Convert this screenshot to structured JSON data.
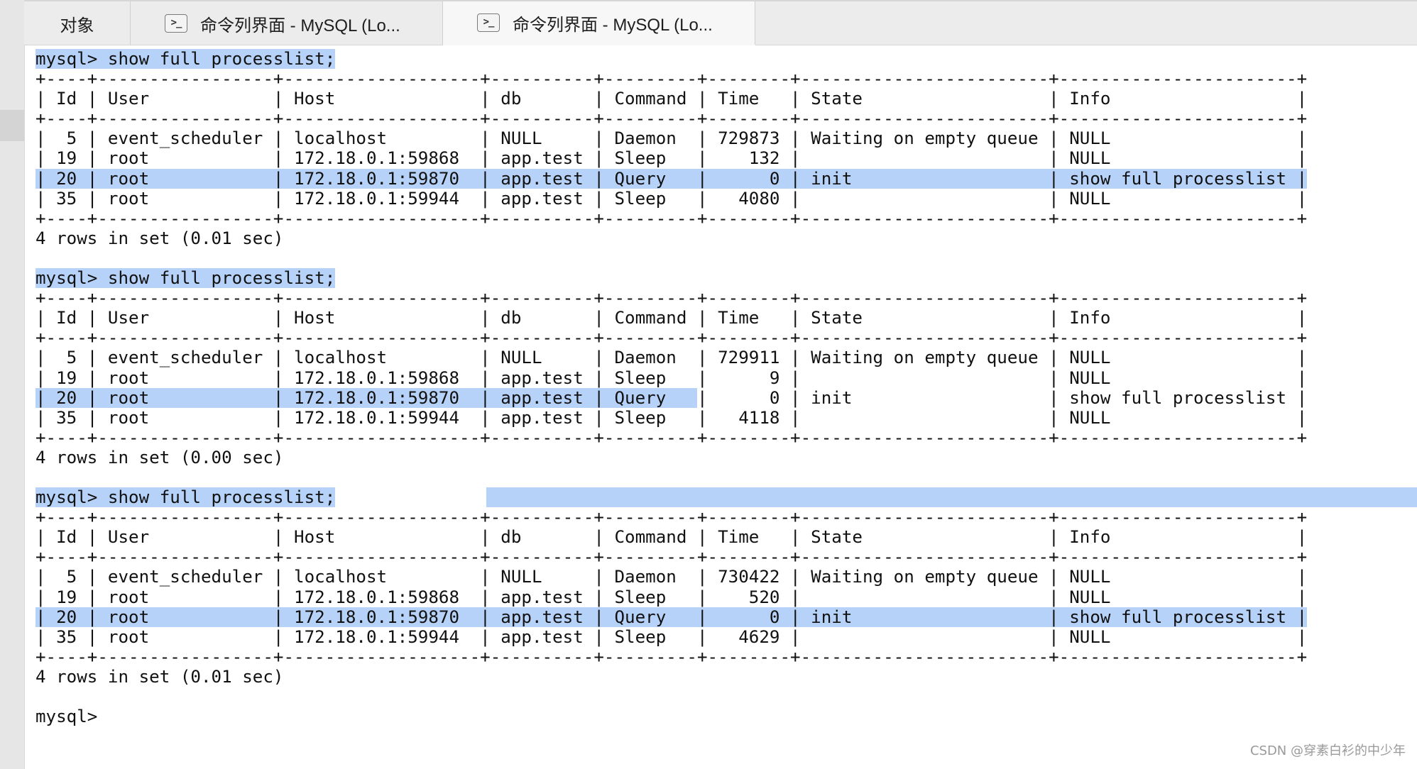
{
  "tabs": [
    {
      "label": "对象"
    },
    {
      "label": "命令列界面 - MySQL (Lo...",
      "icon": "terminal-icon"
    },
    {
      "label": "命令列界面 - MySQL (Lo...",
      "icon": "terminal-icon"
    }
  ],
  "terminal": {
    "prompt": "mysql>",
    "command": " show full processlist;",
    "border": "+----+-----------------+-------------------+----------+---------+--------+------------------------+-----------------------+",
    "header": "| Id | User            | Host              | db       | Command | Time   | State                  | Info                  |",
    "results": [
      {
        "rows": [
          "|  5 | event_scheduler | localhost         | NULL     | Daemon  | 729873 | Waiting on empty queue | NULL                  |",
          "| 19 | root            | 172.18.0.1:59868  | app.test | Sleep   |    132 |                        | NULL                  |",
          "| 20 | root            | 172.18.0.1:59870  | app.test | Query   |      0 | init                   | show full processlist |",
          "| 35 | root            | 172.18.0.1:59944  | app.test | Sleep   |   4080 |                        | NULL                  |"
        ],
        "footer": "4 rows in set (0.01 sec)"
      },
      {
        "rows": [
          "|  5 | event_scheduler | localhost         | NULL     | Daemon  | 729911 | Waiting on empty queue | NULL                  |",
          "| 19 | root            | 172.18.0.1:59868  | app.test | Sleep   |      9 |                        | NULL                  |",
          "| 20 | root            | 172.18.0.1:59870  | app.test | Query   |      0 | init                   | show full processlist |",
          "| 35 | root            | 172.18.0.1:59944  | app.test | Sleep   |   4118 |                        | NULL                  |"
        ],
        "footer": "4 rows in set (0.00 sec)"
      },
      {
        "rows": [
          "|  5 | event_scheduler | localhost         | NULL     | Daemon  | 730422 | Waiting on empty queue | NULL                  |",
          "| 19 | root            | 172.18.0.1:59868  | app.test | Sleep   |    520 |                        | NULL                  |",
          "| 20 | root            | 172.18.0.1:59870  | app.test | Query   |      0 | init                   | show full processlist |",
          "| 35 | root            | 172.18.0.1:59944  | app.test | Sleep   |   4629 |                        | NULL                  |"
        ],
        "footer": "4 rows in set (0.01 sec)"
      }
    ],
    "final_prompt": "mysql>"
  },
  "watermark": "CSDN @穿素白衫的中少年",
  "colors": {
    "selection": "#b6d2f8",
    "tabbar": "#ececec",
    "active_tab": "#f7f7f7"
  }
}
